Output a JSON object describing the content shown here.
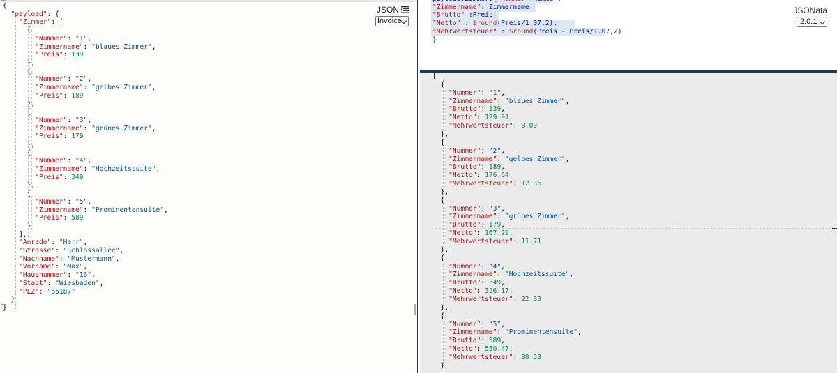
{
  "input_panel": {
    "mode_label": "JSON",
    "mode_icon": "format-lines-icon",
    "sample_select": "Invoice",
    "lines": [
      [
        {
          "t": "p",
          "v": "{"
        }
      ],
      [
        {
          "t": "p",
          "v": "  "
        },
        {
          "t": "k",
          "v": "\"payload\""
        },
        {
          "t": "p",
          "v": ": {"
        }
      ],
      [
        {
          "t": "p",
          "v": "    "
        },
        {
          "t": "k",
          "v": "\"Zimmer\""
        },
        {
          "t": "p",
          "v": ": ["
        }
      ],
      [
        {
          "t": "p",
          "v": "      {"
        }
      ],
      [
        {
          "t": "p",
          "v": "        "
        },
        {
          "t": "k",
          "v": "\"Nummer\""
        },
        {
          "t": "p",
          "v": ": "
        },
        {
          "t": "s",
          "v": "\"1\""
        },
        {
          "t": "p",
          "v": ","
        }
      ],
      [
        {
          "t": "p",
          "v": "        "
        },
        {
          "t": "k",
          "v": "\"Zimmername\""
        },
        {
          "t": "p",
          "v": ": "
        },
        {
          "t": "s",
          "v": "\"blaues Zimmer\""
        },
        {
          "t": "p",
          "v": ","
        }
      ],
      [
        {
          "t": "p",
          "v": "        "
        },
        {
          "t": "k",
          "v": "\"Preis\""
        },
        {
          "t": "p",
          "v": ": "
        },
        {
          "t": "n",
          "v": "139"
        }
      ],
      [
        {
          "t": "p",
          "v": "      },"
        }
      ],
      [
        {
          "t": "p",
          "v": "      {"
        }
      ],
      [
        {
          "t": "p",
          "v": "        "
        },
        {
          "t": "k",
          "v": "\"Nummer\""
        },
        {
          "t": "p",
          "v": ": "
        },
        {
          "t": "s",
          "v": "\"2\""
        },
        {
          "t": "p",
          "v": ","
        }
      ],
      [
        {
          "t": "p",
          "v": "        "
        },
        {
          "t": "k",
          "v": "\"Zimmername\""
        },
        {
          "t": "p",
          "v": ": "
        },
        {
          "t": "s",
          "v": "\"gelbes Zimmer\""
        },
        {
          "t": "p",
          "v": ","
        }
      ],
      [
        {
          "t": "p",
          "v": "        "
        },
        {
          "t": "k",
          "v": "\"Preis\""
        },
        {
          "t": "p",
          "v": ": "
        },
        {
          "t": "n",
          "v": "189"
        }
      ],
      [
        {
          "t": "p",
          "v": "      },"
        }
      ],
      [
        {
          "t": "p",
          "v": "      {"
        }
      ],
      [
        {
          "t": "p",
          "v": "        "
        },
        {
          "t": "k",
          "v": "\"Nummer\""
        },
        {
          "t": "p",
          "v": ": "
        },
        {
          "t": "s",
          "v": "\"3\""
        },
        {
          "t": "p",
          "v": ","
        }
      ],
      [
        {
          "t": "p",
          "v": "        "
        },
        {
          "t": "k",
          "v": "\"Zimmername\""
        },
        {
          "t": "p",
          "v": ": "
        },
        {
          "t": "s",
          "v": "\"grünes Zimmer\""
        },
        {
          "t": "p",
          "v": ","
        }
      ],
      [
        {
          "t": "p",
          "v": "        "
        },
        {
          "t": "k",
          "v": "\"Preis\""
        },
        {
          "t": "p",
          "v": ": "
        },
        {
          "t": "n",
          "v": "179"
        }
      ],
      [
        {
          "t": "p",
          "v": "      },"
        }
      ],
      [
        {
          "t": "p",
          "v": "      {"
        }
      ],
      [
        {
          "t": "p",
          "v": "        "
        },
        {
          "t": "k",
          "v": "\"Nummer\""
        },
        {
          "t": "p",
          "v": ": "
        },
        {
          "t": "s",
          "v": "\"4\""
        },
        {
          "t": "p",
          "v": ","
        }
      ],
      [
        {
          "t": "p",
          "v": "        "
        },
        {
          "t": "k",
          "v": "\"Zimmername\""
        },
        {
          "t": "p",
          "v": ": "
        },
        {
          "t": "s",
          "v": "\"Hochzeitssuite\""
        },
        {
          "t": "p",
          "v": ","
        }
      ],
      [
        {
          "t": "p",
          "v": "        "
        },
        {
          "t": "k",
          "v": "\"Preis\""
        },
        {
          "t": "p",
          "v": ": "
        },
        {
          "t": "n",
          "v": "349"
        }
      ],
      [
        {
          "t": "p",
          "v": "      },"
        }
      ],
      [
        {
          "t": "p",
          "v": "      {"
        }
      ],
      [
        {
          "t": "p",
          "v": "        "
        },
        {
          "t": "k",
          "v": "\"Nummer\""
        },
        {
          "t": "p",
          "v": ": "
        },
        {
          "t": "s",
          "v": "\"5\""
        },
        {
          "t": "p",
          "v": ","
        }
      ],
      [
        {
          "t": "p",
          "v": "        "
        },
        {
          "t": "k",
          "v": "\"Zimmername\""
        },
        {
          "t": "p",
          "v": ": "
        },
        {
          "t": "s",
          "v": "\"Prominentensuite\""
        },
        {
          "t": "p",
          "v": ","
        }
      ],
      [
        {
          "t": "p",
          "v": "        "
        },
        {
          "t": "k",
          "v": "\"Preis\""
        },
        {
          "t": "p",
          "v": ": "
        },
        {
          "t": "n",
          "v": "589"
        }
      ],
      [
        {
          "t": "p",
          "v": "      }"
        }
      ],
      [
        {
          "t": "p",
          "v": "    ],"
        }
      ],
      [
        {
          "t": "p",
          "v": "    "
        },
        {
          "t": "k",
          "v": "\"Anrede\""
        },
        {
          "t": "p",
          "v": ": "
        },
        {
          "t": "s",
          "v": "\"Herr\""
        },
        {
          "t": "p",
          "v": ","
        }
      ],
      [
        {
          "t": "p",
          "v": "    "
        },
        {
          "t": "k",
          "v": "\"Strasse\""
        },
        {
          "t": "p",
          "v": ": "
        },
        {
          "t": "s",
          "v": "\"Schlossallee\""
        },
        {
          "t": "p",
          "v": ","
        }
      ],
      [
        {
          "t": "p",
          "v": "    "
        },
        {
          "t": "k",
          "v": "\"Nachname\""
        },
        {
          "t": "p",
          "v": ": "
        },
        {
          "t": "s",
          "v": "\"Mustermann\""
        },
        {
          "t": "p",
          "v": ","
        }
      ],
      [
        {
          "t": "p",
          "v": "    "
        },
        {
          "t": "k",
          "v": "\"Vorname\""
        },
        {
          "t": "p",
          "v": ": "
        },
        {
          "t": "s",
          "v": "\"Max\""
        },
        {
          "t": "p",
          "v": ","
        }
      ],
      [
        {
          "t": "p",
          "v": "    "
        },
        {
          "t": "k",
          "v": "\"Hausnummer\""
        },
        {
          "t": "p",
          "v": ": "
        },
        {
          "t": "s",
          "v": "\"16\""
        },
        {
          "t": "p",
          "v": ","
        }
      ],
      [
        {
          "t": "p",
          "v": "    "
        },
        {
          "t": "k",
          "v": "\"Stadt\""
        },
        {
          "t": "p",
          "v": ": "
        },
        {
          "t": "s",
          "v": "\"Wiesbaden\""
        },
        {
          "t": "p",
          "v": ","
        }
      ],
      [
        {
          "t": "p",
          "v": "    "
        },
        {
          "t": "k",
          "v": "\"PLZ\""
        },
        {
          "t": "p",
          "v": ": "
        },
        {
          "t": "s",
          "v": "\"65187\""
        }
      ],
      [
        {
          "t": "p",
          "v": "  }"
        }
      ],
      [
        {
          "t": "p",
          "v": "}"
        }
      ]
    ]
  },
  "expression_panel": {
    "mode_label": "JSONata",
    "version_select": "2.0.1",
    "lines": [
      [
        {
          "t": "plain",
          "v": "payload.Zimmer.{"
        },
        {
          "t": "k",
          "v": "\"Nummer\""
        },
        {
          "t": "plain",
          "v": ":Nummer,"
        }
      ],
      [
        {
          "t": "k",
          "v": "\"Zimmername\""
        },
        {
          "t": "plain",
          "v": ": Zimmername,"
        }
      ],
      [
        {
          "t": "k",
          "v": "\"Brutto\""
        },
        {
          "t": "plain",
          "v": " :Preis,"
        }
      ],
      [
        {
          "t": "k",
          "v": "\"Netto\""
        },
        {
          "t": "plain",
          "v": " : "
        },
        {
          "t": "fc",
          "v": "$round"
        },
        {
          "t": "plain",
          "v": "(Preis/1.07,2),"
        }
      ],
      [
        {
          "t": "k",
          "v": "\"Mehrwertsteuer\""
        },
        {
          "t": "plain",
          "v": " : "
        },
        {
          "t": "fc",
          "v": "$round"
        },
        {
          "t": "plain",
          "v": "(Preis - Preis/1.07,2)"
        }
      ],
      [
        {
          "t": "plain",
          "v": "}"
        }
      ]
    ]
  },
  "result_panel": {
    "lines": [
      [
        {
          "t": "p",
          "v": "["
        }
      ],
      [
        {
          "t": "p",
          "v": "  {"
        }
      ],
      [
        {
          "t": "p",
          "v": "    "
        },
        {
          "t": "k",
          "v": "\"Nummer\""
        },
        {
          "t": "p",
          "v": ": "
        },
        {
          "t": "s",
          "v": "\"1\""
        },
        {
          "t": "p",
          "v": ","
        }
      ],
      [
        {
          "t": "p",
          "v": "    "
        },
        {
          "t": "k",
          "v": "\"Zimmername\""
        },
        {
          "t": "p",
          "v": ": "
        },
        {
          "t": "s",
          "v": "\"blaues Zimmer\""
        },
        {
          "t": "p",
          "v": ","
        }
      ],
      [
        {
          "t": "p",
          "v": "    "
        },
        {
          "t": "k",
          "v": "\"Brutto\""
        },
        {
          "t": "p",
          "v": ": "
        },
        {
          "t": "n",
          "v": "139"
        },
        {
          "t": "p",
          "v": ","
        }
      ],
      [
        {
          "t": "p",
          "v": "    "
        },
        {
          "t": "k",
          "v": "\"Netto\""
        },
        {
          "t": "p",
          "v": ": "
        },
        {
          "t": "n",
          "v": "129.91"
        },
        {
          "t": "p",
          "v": ","
        }
      ],
      [
        {
          "t": "p",
          "v": "    "
        },
        {
          "t": "k",
          "v": "\"Mehrwertsteuer\""
        },
        {
          "t": "p",
          "v": ": "
        },
        {
          "t": "n",
          "v": "9.09"
        }
      ],
      [
        {
          "t": "p",
          "v": "  },"
        }
      ],
      [
        {
          "t": "p",
          "v": "  {"
        }
      ],
      [
        {
          "t": "p",
          "v": "    "
        },
        {
          "t": "k",
          "v": "\"Nummer\""
        },
        {
          "t": "p",
          "v": ": "
        },
        {
          "t": "s",
          "v": "\"2\""
        },
        {
          "t": "p",
          "v": ","
        }
      ],
      [
        {
          "t": "p",
          "v": "    "
        },
        {
          "t": "k",
          "v": "\"Zimmername\""
        },
        {
          "t": "p",
          "v": ": "
        },
        {
          "t": "s",
          "v": "\"gelbes Zimmer\""
        },
        {
          "t": "p",
          "v": ","
        }
      ],
      [
        {
          "t": "p",
          "v": "    "
        },
        {
          "t": "k",
          "v": "\"Brutto\""
        },
        {
          "t": "p",
          "v": ": "
        },
        {
          "t": "n",
          "v": "189"
        },
        {
          "t": "p",
          "v": ","
        }
      ],
      [
        {
          "t": "p",
          "v": "    "
        },
        {
          "t": "k",
          "v": "\"Netto\""
        },
        {
          "t": "p",
          "v": ": "
        },
        {
          "t": "n",
          "v": "176.64"
        },
        {
          "t": "p",
          "v": ","
        }
      ],
      [
        {
          "t": "p",
          "v": "    "
        },
        {
          "t": "k",
          "v": "\"Mehrwertsteuer\""
        },
        {
          "t": "p",
          "v": ": "
        },
        {
          "t": "n",
          "v": "12.36"
        }
      ],
      [
        {
          "t": "p",
          "v": "  },"
        }
      ],
      [
        {
          "t": "p",
          "v": "  {"
        }
      ],
      [
        {
          "t": "p",
          "v": "    "
        },
        {
          "t": "k",
          "v": "\"Nummer\""
        },
        {
          "t": "p",
          "v": ": "
        },
        {
          "t": "s",
          "v": "\"3\""
        },
        {
          "t": "p",
          "v": ","
        }
      ],
      [
        {
          "t": "p",
          "v": "    "
        },
        {
          "t": "k",
          "v": "\"Zimmername\""
        },
        {
          "t": "p",
          "v": ": "
        },
        {
          "t": "s",
          "v": "\"grünes Zimmer\""
        },
        {
          "t": "p",
          "v": ","
        }
      ],
      [
        {
          "t": "p",
          "v": "    "
        },
        {
          "t": "k",
          "v": "\"Brutto\""
        },
        {
          "t": "p",
          "v": ": "
        },
        {
          "t": "n",
          "v": "179"
        },
        {
          "t": "p",
          "v": ","
        }
      ],
      [
        {
          "t": "p",
          "v": "    "
        },
        {
          "t": "k",
          "v": "\"Netto\""
        },
        {
          "t": "p",
          "v": ": "
        },
        {
          "t": "n",
          "v": "167.29"
        },
        {
          "t": "p",
          "v": ","
        }
      ],
      [
        {
          "t": "p",
          "v": "    "
        },
        {
          "t": "k",
          "v": "\"Mehrwertsteuer\""
        },
        {
          "t": "p",
          "v": ": "
        },
        {
          "t": "n",
          "v": "11.71"
        }
      ],
      [
        {
          "t": "p",
          "v": "  },"
        }
      ],
      [
        {
          "t": "p",
          "v": "  {"
        }
      ],
      [
        {
          "t": "p",
          "v": "    "
        },
        {
          "t": "k",
          "v": "\"Nummer\""
        },
        {
          "t": "p",
          "v": ": "
        },
        {
          "t": "s",
          "v": "\"4\""
        },
        {
          "t": "p",
          "v": ","
        }
      ],
      [
        {
          "t": "p",
          "v": "    "
        },
        {
          "t": "k",
          "v": "\"Zimmername\""
        },
        {
          "t": "p",
          "v": ": "
        },
        {
          "t": "s",
          "v": "\"Hochzeitssuite\""
        },
        {
          "t": "p",
          "v": ","
        }
      ],
      [
        {
          "t": "p",
          "v": "    "
        },
        {
          "t": "k",
          "v": "\"Brutto\""
        },
        {
          "t": "p",
          "v": ": "
        },
        {
          "t": "n",
          "v": "349"
        },
        {
          "t": "p",
          "v": ","
        }
      ],
      [
        {
          "t": "p",
          "v": "    "
        },
        {
          "t": "k",
          "v": "\"Netto\""
        },
        {
          "t": "p",
          "v": ": "
        },
        {
          "t": "n",
          "v": "326.17"
        },
        {
          "t": "p",
          "v": ","
        }
      ],
      [
        {
          "t": "p",
          "v": "    "
        },
        {
          "t": "k",
          "v": "\"Mehrwertsteuer\""
        },
        {
          "t": "p",
          "v": ": "
        },
        {
          "t": "n",
          "v": "22.83"
        }
      ],
      [
        {
          "t": "p",
          "v": "  },"
        }
      ],
      [
        {
          "t": "p",
          "v": "  {"
        }
      ],
      [
        {
          "t": "p",
          "v": "    "
        },
        {
          "t": "k",
          "v": "\"Nummer\""
        },
        {
          "t": "p",
          "v": ": "
        },
        {
          "t": "s",
          "v": "\"5\""
        },
        {
          "t": "p",
          "v": ","
        }
      ],
      [
        {
          "t": "p",
          "v": "    "
        },
        {
          "t": "k",
          "v": "\"Zimmername\""
        },
        {
          "t": "p",
          "v": ": "
        },
        {
          "t": "s",
          "v": "\"Prominentensuite\""
        },
        {
          "t": "p",
          "v": ","
        }
      ],
      [
        {
          "t": "p",
          "v": "    "
        },
        {
          "t": "k",
          "v": "\"Brutto\""
        },
        {
          "t": "p",
          "v": ": "
        },
        {
          "t": "n",
          "v": "589"
        },
        {
          "t": "p",
          "v": ","
        }
      ],
      [
        {
          "t": "p",
          "v": "    "
        },
        {
          "t": "k",
          "v": "\"Netto\""
        },
        {
          "t": "p",
          "v": ": "
        },
        {
          "t": "n",
          "v": "550.47"
        },
        {
          "t": "p",
          "v": ","
        }
      ],
      [
        {
          "t": "p",
          "v": "    "
        },
        {
          "t": "k",
          "v": "\"Mehrwertsteuer\""
        },
        {
          "t": "p",
          "v": ": "
        },
        {
          "t": "n",
          "v": "38.53"
        }
      ],
      [
        {
          "t": "p",
          "v": "  }"
        }
      ]
    ]
  }
}
